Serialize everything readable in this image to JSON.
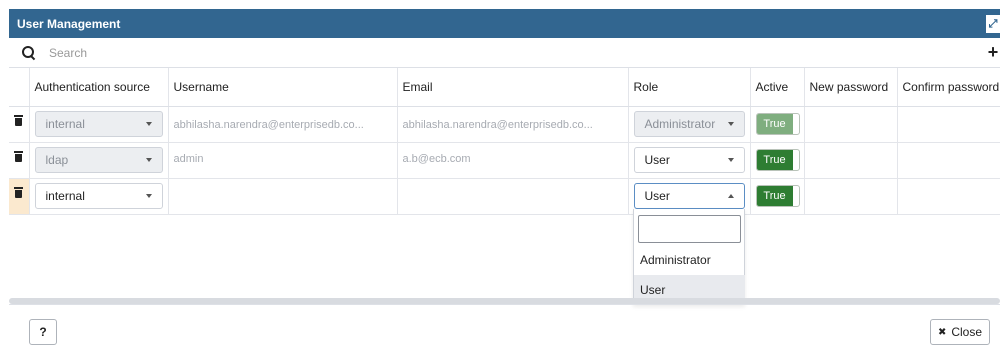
{
  "dialog": {
    "title": "User Management",
    "expand_icon": "expand-icon"
  },
  "search": {
    "icon": "search-icon",
    "placeholder": "Search",
    "add_icon": "plus-icon",
    "add_label": "+"
  },
  "table": {
    "columns": [
      "Authentication source",
      "Username",
      "Email",
      "Role",
      "Active",
      "New password",
      "Confirm password"
    ],
    "rows": [
      {
        "auth_source": "internal",
        "username": "abhilasha.narendra@enterprisedb.co...",
        "email": "abhilasha.narendra@enterprisedb.co...",
        "role": "Administrator",
        "active": "True"
      },
      {
        "auth_source": "ldap",
        "username": "admin",
        "email": "a.b@ecb.com",
        "role": "User",
        "active": "True"
      },
      {
        "auth_source": "internal",
        "username": "",
        "email": "",
        "role": "User",
        "active": "True"
      }
    ]
  },
  "role_dropdown": {
    "search_value": "",
    "options": [
      "Administrator",
      "User"
    ],
    "selected": "User"
  },
  "footer": {
    "help_label": "?",
    "close_icon": "close-icon",
    "close_label": "Close"
  }
}
